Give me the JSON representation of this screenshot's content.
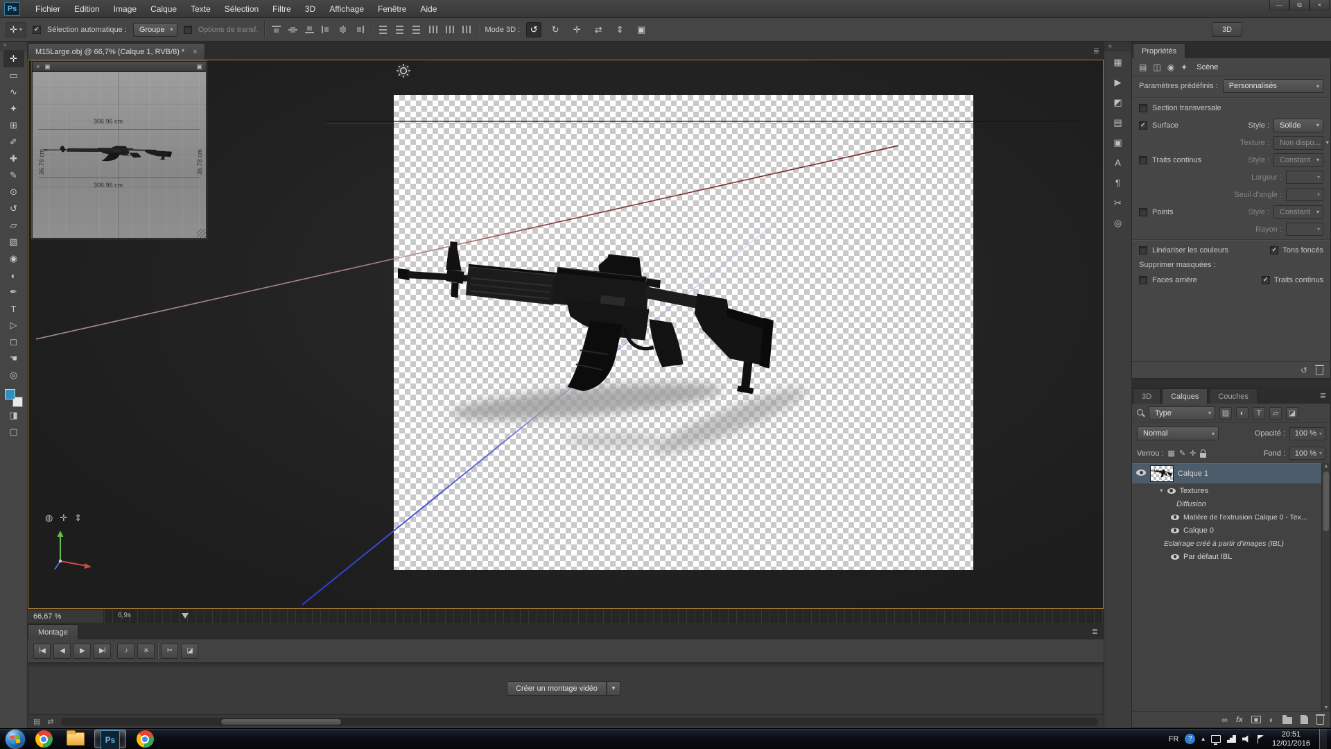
{
  "app": {
    "logo": "Ps",
    "workspace": "3D"
  },
  "menu": {
    "items": [
      "Fichier",
      "Edition",
      "Image",
      "Calque",
      "Texte",
      "Sélection",
      "Filtre",
      "3D",
      "Affichage",
      "Fenêtre",
      "Aide"
    ]
  },
  "window_controls": {
    "minimize": "—",
    "restore": "⧉",
    "close": "×"
  },
  "options": {
    "move_tool": "✛",
    "auto_select_label": "Sélection automatique :",
    "auto_select_value": "Groupe",
    "transform_label": "Options de transf.",
    "mode3d_label": "Mode 3D :",
    "mode3d": {
      "orbit": "↺",
      "roll": "↻",
      "pan": "✛",
      "slide": "⇄",
      "scale": "⇕",
      "camera": "▣"
    }
  },
  "tools": {
    "collapse": "»",
    "move": "✛",
    "marquee": "▭",
    "lasso": "∿",
    "quick_select": "✦",
    "crop": "⊞",
    "eyedropper": "✐",
    "healing": "✚",
    "brush": "✎",
    "clone": "⊙",
    "history": "↺",
    "eraser": "▱",
    "gradient": "▧",
    "blur": "◉",
    "dodge": "◐",
    "pen": "✒",
    "type": "T",
    "path_select": "▷",
    "shape": "◻",
    "hand": "☚",
    "zoom": "◎",
    "quick_mask": "◨",
    "screen_mode": "▢"
  },
  "panel_strip": {
    "expand": "«",
    "icons": [
      "▦",
      "▶",
      "◩",
      "▤",
      "▣",
      "A",
      "¶",
      "✂",
      "◎"
    ]
  },
  "document": {
    "tab": "M15Large.obj @ 66,7% (Calque 1, RVB/8) *",
    "close": "×",
    "zoom": "66,67 %",
    "timecode": "6,9s",
    "menu": "≣"
  },
  "secondary_view": {
    "close": "×",
    "icon": "▣",
    "top": "306.96 cm",
    "bottom": "306.96 cm",
    "left": "36.78 cm",
    "right": "36.78 cm"
  },
  "axis_tools": {
    "orbit": "◍",
    "pan": "✛",
    "zoom": "⇕"
  },
  "montage": {
    "tab": "Montage",
    "menu": "≣",
    "create_button": "Créer un montage vidéo",
    "bottom_icons": [
      "▤",
      "⇄"
    ],
    "transport": {
      "first": "Ⅰ◀",
      "prev": "◀",
      "play": "▶",
      "next": "▶Ⅰ",
      "audio": "♪",
      "settings": "✳",
      "split": "✂",
      "transition": "◪"
    }
  },
  "properties": {
    "tab": "Propriétés",
    "header_icons": [
      "▤",
      "◫",
      "◉",
      "✦"
    ],
    "title": "Scène",
    "presets_label": "Paramètres prédéfinis :",
    "presets_value": "Personnalisés",
    "cross_section": "Section transversale",
    "surface": "Surface",
    "style_label": "Style :",
    "surface_style": "Solide",
    "texture_label": "Texture :",
    "texture_value": "Non dispo...",
    "lines": "Traits continus",
    "lines_style": "Constant",
    "width_label": "Largeur :",
    "angle_label": "Seuil d'angle :",
    "points": "Points",
    "points_style": "Constant",
    "radius_label": "Rayon :",
    "linearize": "Linéariser les couleurs",
    "dark_tones": "Tons foncés",
    "remove_hidden": "Supprimer masquées :",
    "back_faces": "Faces arrière",
    "hidden_lines": "Traits continus",
    "refresh_icon": "↺"
  },
  "panel_tabs": {
    "three_d": "3D",
    "layers": "Calques",
    "channels": "Couches",
    "menu": "≣"
  },
  "layers": {
    "filter_value": "Type",
    "filter_icons": [
      "▨",
      "◐",
      "T",
      "▱",
      "◪"
    ],
    "blend_mode": "Normal",
    "opacity_label": "Opacité :",
    "opacity_value": "100 %",
    "lock_label": "Verrou :",
    "lock_icons": [
      "▦",
      "✎",
      "✛"
    ],
    "fill_label": "Fond :",
    "fill_value": "100 %",
    "disclosure": "▾",
    "rows": [
      {
        "name": "Calque 1"
      },
      {
        "name": "Textures"
      },
      {
        "name": "Diffusion"
      },
      {
        "name": "Matière de l'extrusion Calque 0 - Tex..."
      },
      {
        "name": "Calque 0"
      },
      {
        "name": "Eclairage créé à partir d'images (IBL)"
      },
      {
        "name": "Par défaut IBL"
      }
    ],
    "bottom": {
      "link": "∞",
      "fx": "fx",
      "adjust": "◐"
    }
  },
  "taskbar": {
    "language": "FR",
    "help": "?",
    "expand": "▴",
    "time": "20:51",
    "date": "12/01/2016"
  }
}
